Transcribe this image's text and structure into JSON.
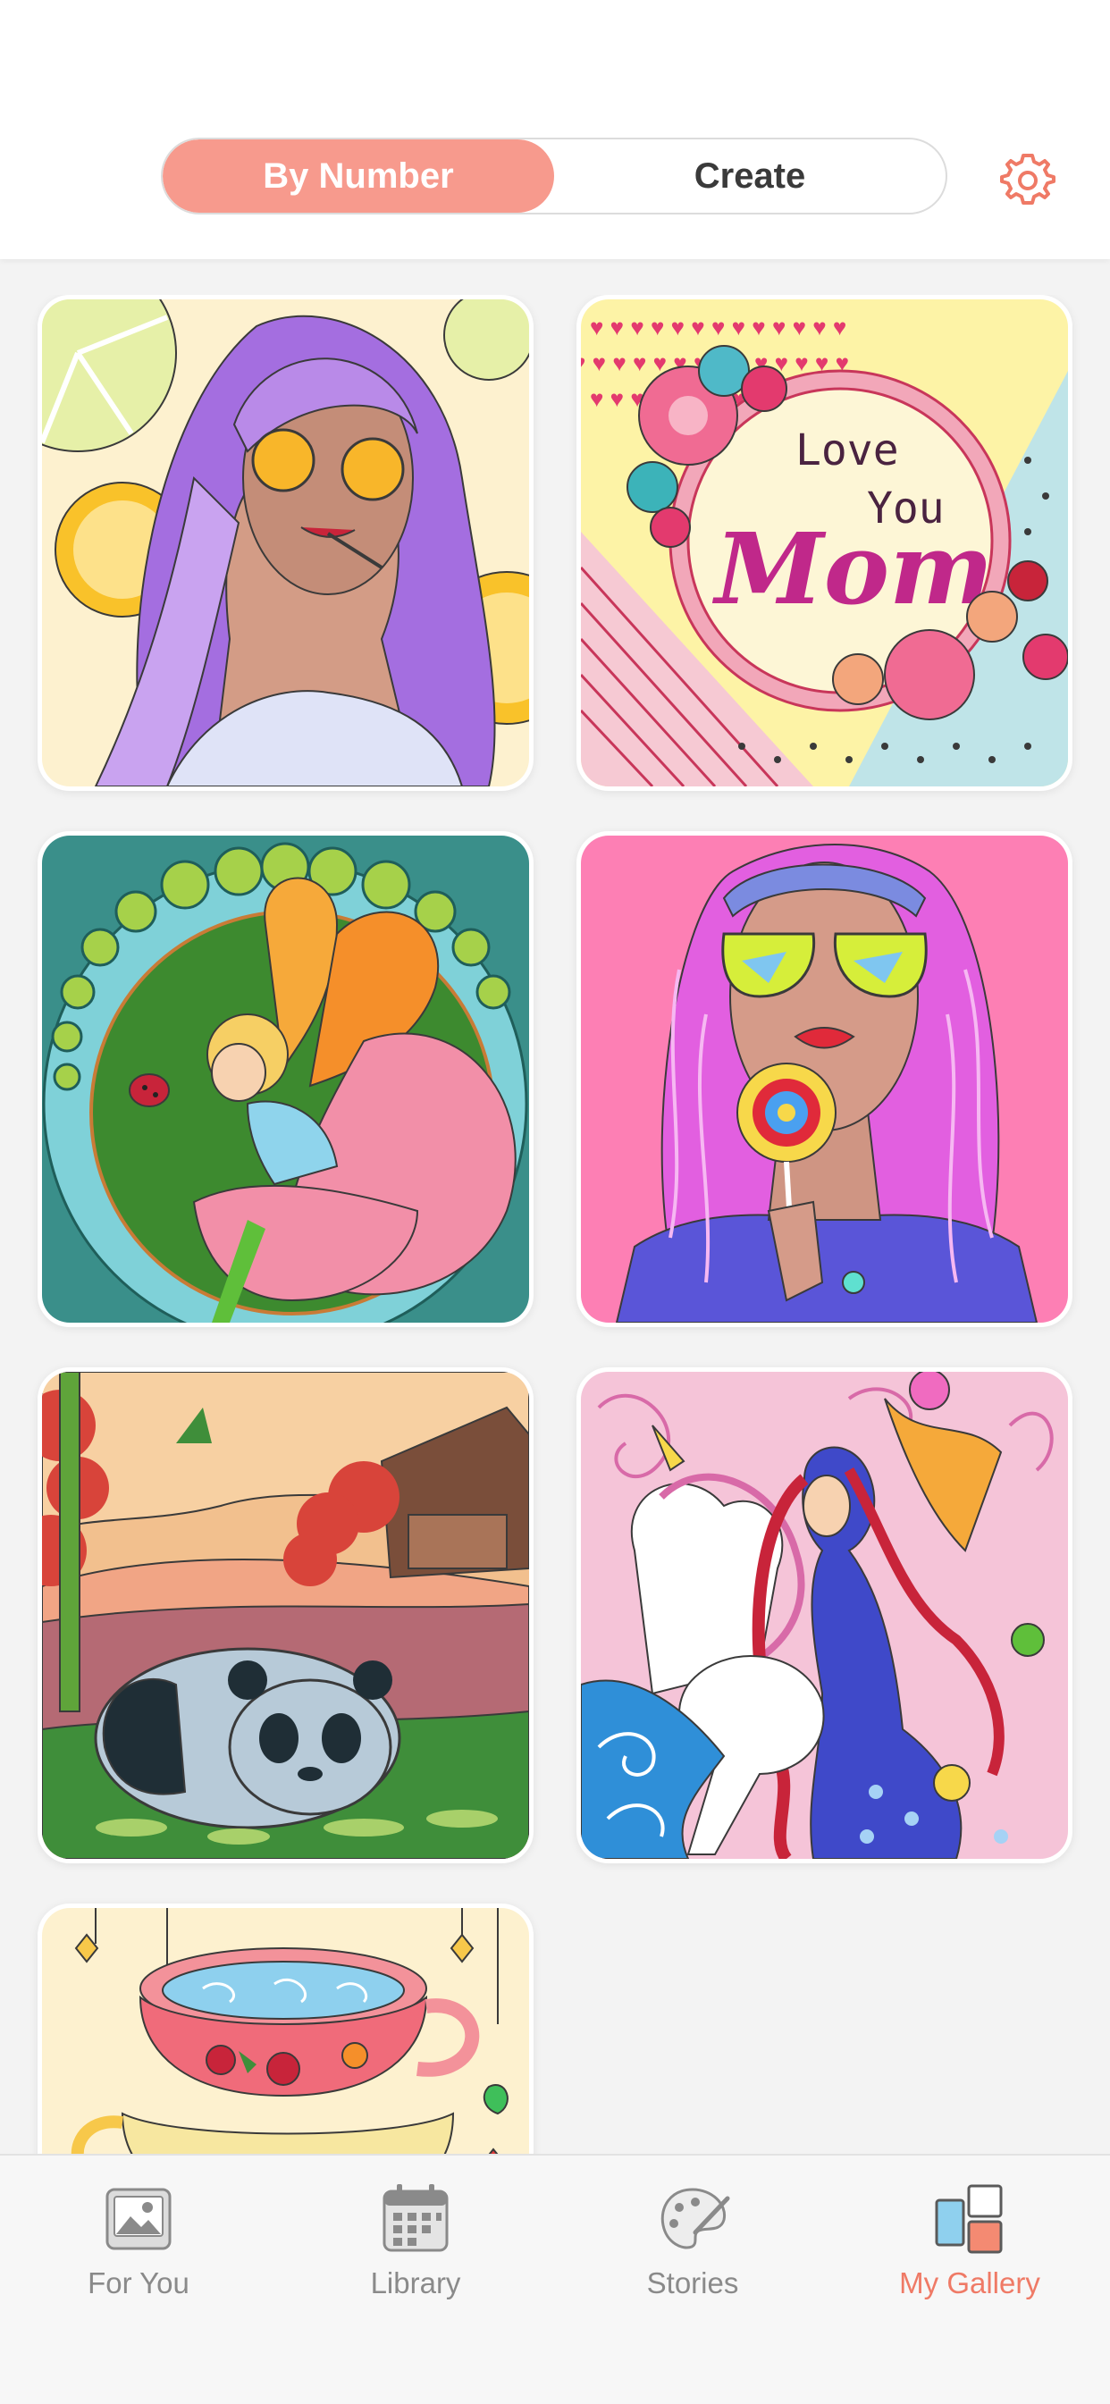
{
  "header": {
    "segments": [
      {
        "label": "By Number",
        "active": true
      },
      {
        "label": "Create",
        "active": false
      }
    ],
    "settings_icon": "gear-icon"
  },
  "gallery": {
    "items": [
      {
        "subject": "girl with purple hair and sunglasses, lemons"
      },
      {
        "subject": "Love You Mom card with flowers",
        "text_line1": "Love",
        "text_line2": "You",
        "text_line3": "Mom"
      },
      {
        "subject": "fairy with butterfly wings and ladybug"
      },
      {
        "subject": "girl with pink hair and lollipop"
      },
      {
        "subject": "panda lying on grass near house"
      },
      {
        "subject": "fairy with unicorns"
      },
      {
        "subject": "stacked teacups"
      }
    ]
  },
  "tabbar": {
    "tabs": [
      {
        "label": "For You",
        "icon": "photo-icon",
        "active": false
      },
      {
        "label": "Library",
        "icon": "calendar-icon",
        "active": false
      },
      {
        "label": "Stories",
        "icon": "palette-icon",
        "active": false
      },
      {
        "label": "My Gallery",
        "icon": "gallery-icon",
        "active": true
      }
    ]
  },
  "colors": {
    "accent": "#f79a8d",
    "active_tab": "#ef7a66",
    "inactive_tab": "#8a8a8a",
    "background": "#f3f3f3"
  }
}
